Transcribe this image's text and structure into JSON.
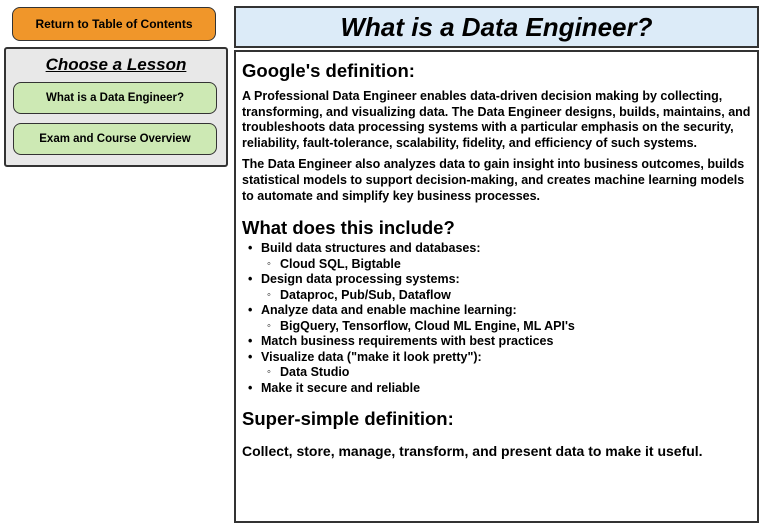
{
  "nav": {
    "toc_button": "Return to Table of Contents",
    "lesson_heading": "Choose a Lesson",
    "lessons": [
      "What is a Data Engineer?",
      "Exam and Course Overview"
    ]
  },
  "page": {
    "title": "What is a Data Engineer?"
  },
  "content": {
    "section1_heading": "Google's definition:",
    "para1": "A Professional Data Engineer enables data-driven decision making by collecting, transforming, and visualizing data. The Data Engineer designs, builds, maintains, and troubleshoots data processing systems with a particular emphasis on the security, reliability, fault-tolerance, scalability, fidelity, and efficiency of such systems.",
    "para2": "The Data Engineer also analyzes data to gain insight into business outcomes, builds statistical models to support decision-making, and creates machine learning models to automate and simplify key business processes.",
    "section2_heading": "What does this include?",
    "items": [
      {
        "text": "Build data structures and databases:",
        "sub": [
          "Cloud SQL, Bigtable"
        ]
      },
      {
        "text": "Design data processing systems:",
        "sub": [
          "Dataproc, Pub/Sub, Dataflow"
        ]
      },
      {
        "text": "Analyze data and enable machine learning:",
        "sub": [
          "BigQuery, Tensorflow, Cloud ML Engine, ML API's"
        ]
      },
      {
        "text": "Match business requirements with best practices",
        "sub": []
      },
      {
        "text": "Visualize data (\"make it look pretty\"):",
        "sub": [
          "Data Studio"
        ]
      },
      {
        "text": "Make it secure and reliable",
        "sub": []
      }
    ],
    "section3_heading": "Super-simple definition:",
    "final": "Collect, store, manage, transform, and present data to make it useful."
  },
  "colors": {
    "toc_button": "#f0962a",
    "lesson_button": "#cde9b4",
    "title_bar": "#dcebf8",
    "panel": "#e8e8e8"
  }
}
